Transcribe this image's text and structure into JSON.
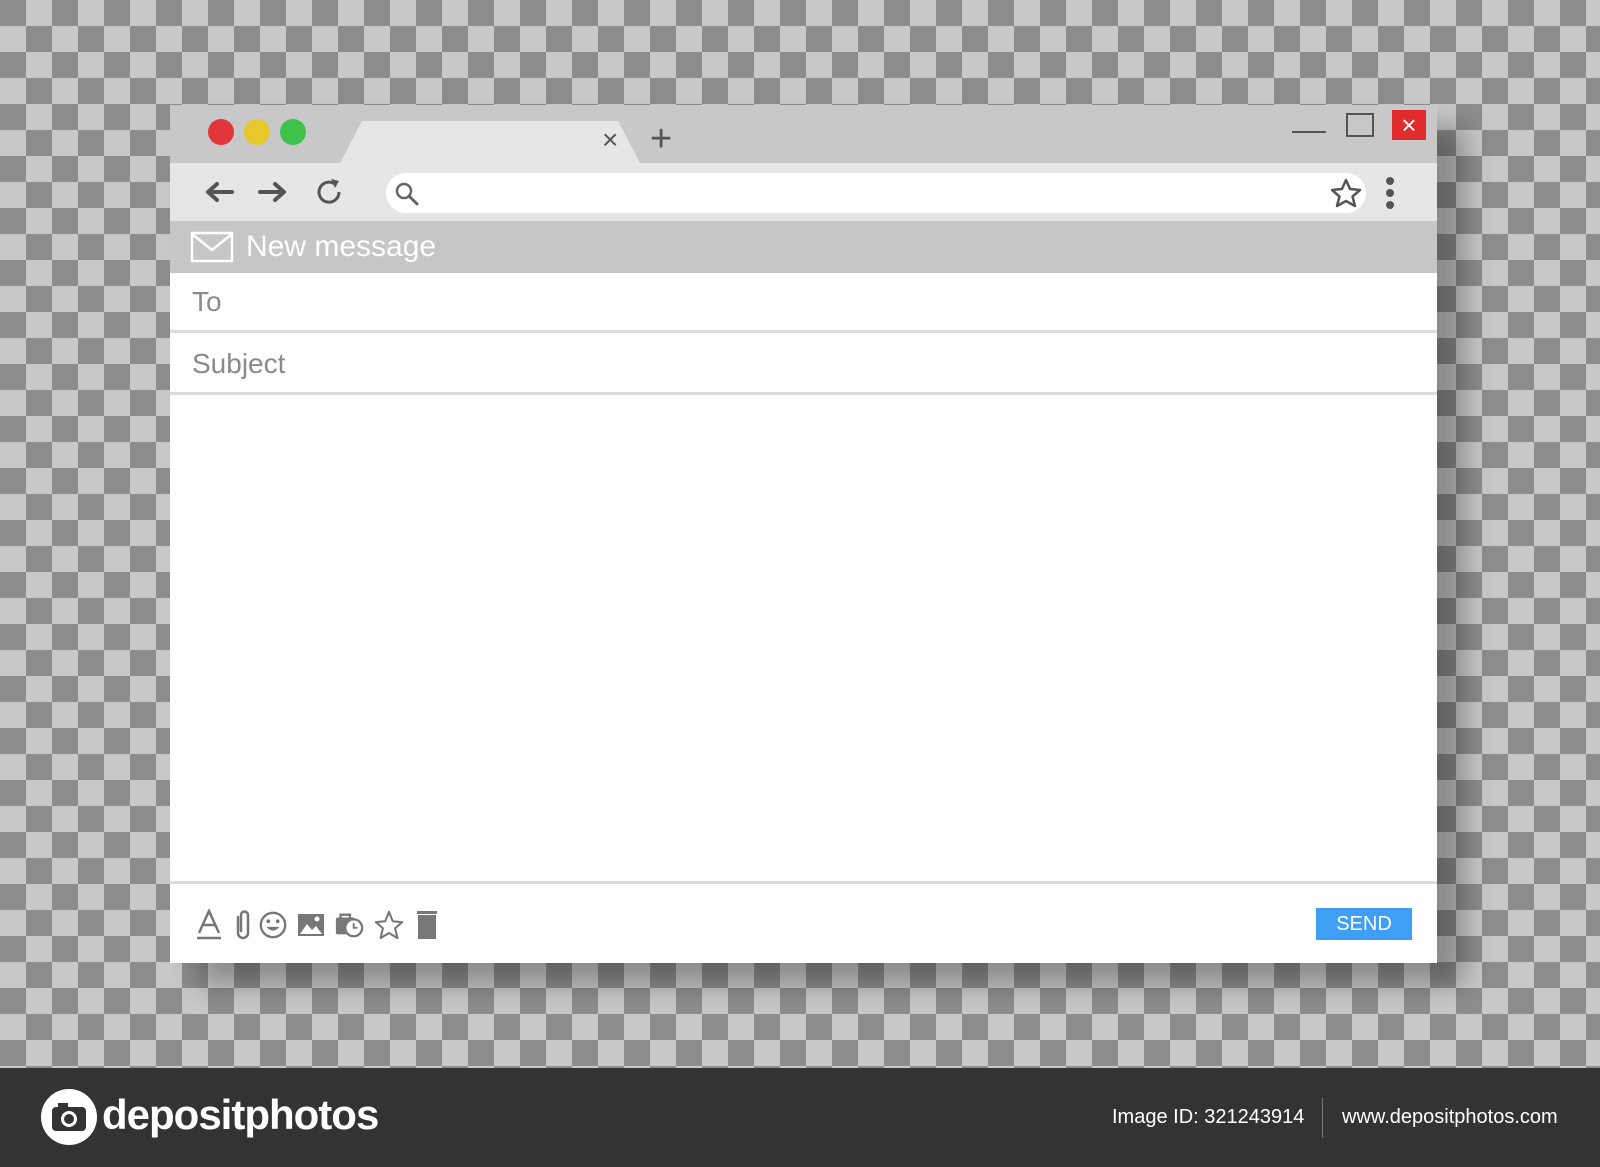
{
  "browser": {
    "traffic_lights": {
      "close": "#e0353a",
      "minimize": "#e6c82b",
      "maximize": "#3ec14a"
    },
    "tab_close_glyph": "×",
    "new_tab_glyph": "+",
    "window_close_glyph": "×",
    "window_close_color": "#e02c2c",
    "address_placeholder": ""
  },
  "compose": {
    "title": "New message",
    "to_label": "To",
    "subject_label": "Subject",
    "send_label": "SEND",
    "send_color": "#3f9ff5",
    "footer_icons": [
      "text-format-icon",
      "attachment-icon",
      "emoji-icon",
      "image-icon",
      "schedule-icon",
      "star-icon",
      "trash-icon"
    ]
  },
  "watermark_bar": {
    "brand": "depositphotos",
    "image_id": "Image ID: 321243914",
    "site": "www.depositphotos.com"
  }
}
